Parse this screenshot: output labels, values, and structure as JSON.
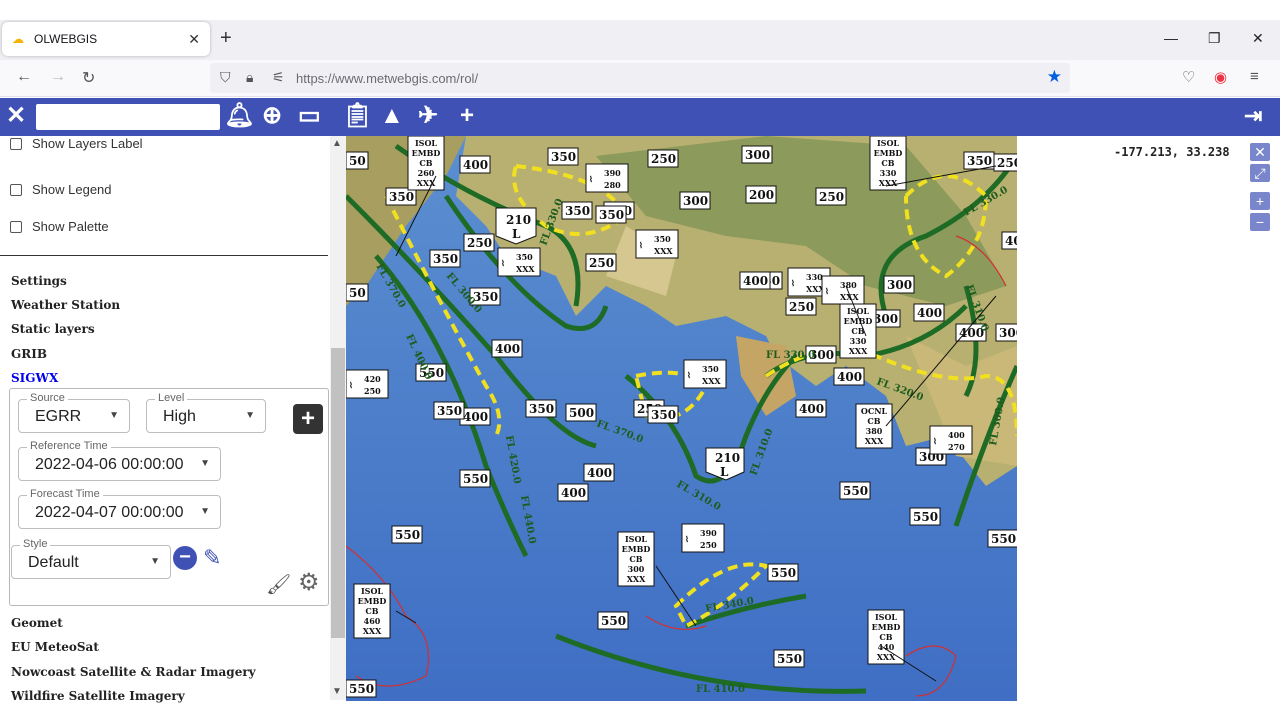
{
  "browser": {
    "tab_title": "OLWEBGIS",
    "url": "https://www.metwebgis.com/rol/"
  },
  "sidebar": {
    "checkboxes": [
      "Show Layers Label",
      "Show Legend",
      "Show Palette"
    ],
    "sections": [
      "Settings",
      "Weather Station",
      "Static layers",
      "GRIB",
      "SIGWX"
    ],
    "sections_after": [
      "Geomet",
      "EU MeteoSat",
      "Nowcoast Satellite & Radar Imagery",
      "Wildfire Satellite Imagery"
    ],
    "sigwx": {
      "source_label": "Source",
      "source_value": "EGRR",
      "level_label": "Level",
      "level_value": "High",
      "reference_label": "Reference Time",
      "reference_value": "2022-04-06 00:00:00",
      "forecast_label": "Forecast Time",
      "forecast_value": "2022-04-07 00:00:00",
      "style_label": "Style",
      "style_value": "Default"
    }
  },
  "map": {
    "coordinates": "-177.213, 33.238",
    "flight_levels": [
      "50",
      "400",
      "350",
      "250",
      "300",
      "400",
      "200",
      "250",
      "300",
      "350",
      "350",
      "250",
      "350",
      "250",
      "350",
      "250",
      "250",
      "350",
      "50",
      "350",
      "300",
      "350",
      "250",
      "400",
      "300",
      "300",
      "300",
      "400",
      "400",
      "550",
      "350",
      "350",
      "250",
      "400",
      "500",
      "300",
      "400",
      "350",
      "400",
      "400",
      "550",
      "400",
      "400",
      "550",
      "550",
      "550",
      "550",
      "550",
      "550",
      "550",
      "550",
      "210",
      "210"
    ],
    "cb_boxes": [
      {
        "lines": [
          "ISOL",
          "EMBD",
          "CB",
          "260",
          "XXX"
        ]
      },
      {
        "lines": [
          "ISOL",
          "EMBD",
          "CB",
          "330",
          "XXX"
        ]
      },
      {
        "lines": [
          "ISOL",
          "EMBD",
          "CB",
          "330",
          "XXX"
        ]
      },
      {
        "lines": [
          "OCNL",
          "CB",
          "380",
          "XXX"
        ]
      },
      {
        "lines": [
          "ISOL",
          "EMBD",
          "CB",
          "300",
          "XXX"
        ]
      },
      {
        "lines": [
          "ISOL",
          "EMBD",
          "CB",
          "460",
          "XXX"
        ]
      },
      {
        "lines": [
          "ISOL",
          "EMBD",
          "CB",
          "440",
          "XXX"
        ]
      }
    ],
    "turbulence_boxes": [
      {
        "top": "390",
        "bottom": "280"
      },
      {
        "top": "350",
        "bottom": "XXX"
      },
      {
        "top": "350",
        "bottom": "XXX"
      },
      {
        "top": "330",
        "bottom": "XXX"
      },
      {
        "top": "380",
        "bottom": "XXX"
      },
      {
        "top": "350",
        "bottom": "XXX"
      },
      {
        "top": "390",
        "bottom": "250"
      },
      {
        "top": "400",
        "bottom": "270"
      },
      {
        "top": "420",
        "bottom": "250"
      }
    ],
    "jet_labels": [
      "FL 370.0",
      "FL 400.0",
      "FL 300.0",
      "FL 330.0",
      "FL 370.0",
      "FL 310.0",
      "FL 310.0",
      "FL 330.0",
      "FL 320.0",
      "FL 310.0",
      "FL 420.0",
      "FL 440.0",
      "FL 340.0",
      "FL 410.0",
      "FL 330.0",
      "FL 300.0"
    ],
    "low_label": "L"
  }
}
